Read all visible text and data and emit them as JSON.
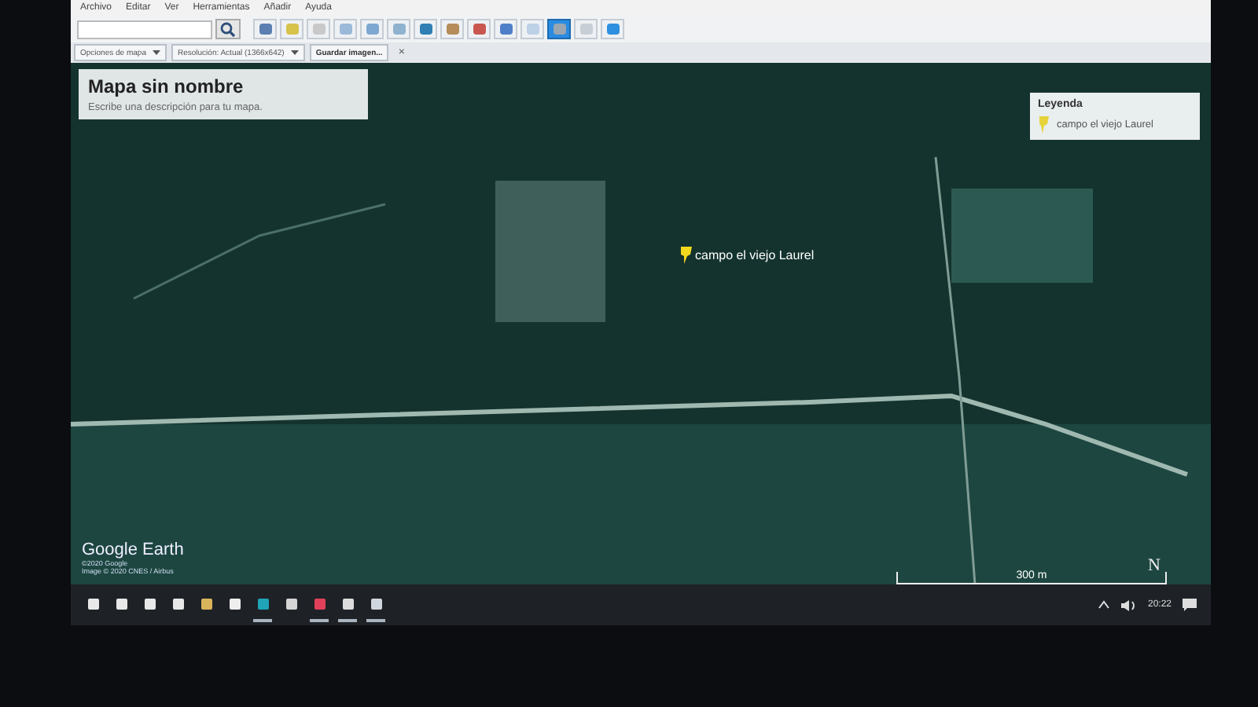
{
  "menu": [
    "Archivo",
    "Editar",
    "Ver",
    "Herramientas",
    "Añadir",
    "Ayuda"
  ],
  "toolbar": {
    "buttons": [
      {
        "selected": false
      },
      {
        "selected": false
      },
      {
        "selected": false
      },
      {
        "selected": false
      },
      {
        "selected": false
      },
      {
        "selected": false
      },
      {
        "selected": false
      },
      {
        "selected": false
      },
      {
        "selected": false
      },
      {
        "selected": false
      },
      {
        "selected": false
      },
      {
        "selected": true
      },
      {
        "selected": false
      },
      {
        "selected": false
      }
    ]
  },
  "options_bar": {
    "map_options": "Opciones de mapa",
    "resolution": "Resolución: Actual (1366x642)",
    "save": "Guardar imagen...",
    "close": "×"
  },
  "map_panel": {
    "title": "Mapa sin nombre",
    "description": "Escribe una descripción para tu mapa."
  },
  "legend": {
    "title": "Leyenda",
    "items": [
      "campo el viejo Laurel"
    ]
  },
  "placemark": {
    "label": "campo el viejo Laurel"
  },
  "attribution": {
    "logo": "Google Earth",
    "copyright": "©2020 Google",
    "imagery": "Image © 2020 CNES / Airbus"
  },
  "scale": {
    "label": "300 m"
  },
  "compass": "N",
  "taskbar": {
    "apps": [
      {
        "running": false
      },
      {
        "running": false
      },
      {
        "running": false
      },
      {
        "running": false
      },
      {
        "running": false
      },
      {
        "running": false
      },
      {
        "running": true
      },
      {
        "running": false
      },
      {
        "running": true
      },
      {
        "running": true
      },
      {
        "running": true
      }
    ],
    "clock": "20:22"
  }
}
